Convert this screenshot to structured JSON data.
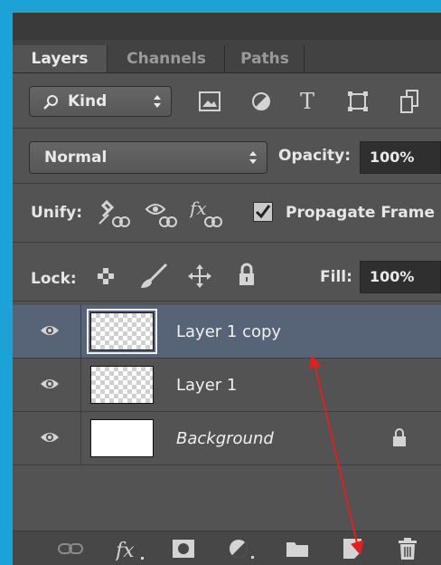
{
  "tabs": [
    {
      "label": "Layers",
      "active": true
    },
    {
      "label": "Channels",
      "active": false
    },
    {
      "label": "Paths",
      "active": false
    }
  ],
  "filter": {
    "kind_label": "Kind",
    "icons": [
      "image-filter-icon",
      "adjustment-filter-icon",
      "type-filter-icon",
      "shape-filter-icon",
      "smart-object-filter-icon"
    ]
  },
  "blend": {
    "mode": "Normal",
    "opacity_label": "Opacity:",
    "opacity_value": "100%"
  },
  "unify": {
    "label": "Unify:",
    "propagate_label": "Propagate Frame",
    "propagate_checked": true
  },
  "lock": {
    "label": "Lock:",
    "fill_label": "Fill:",
    "fill_value": "100%"
  },
  "layers": [
    {
      "name": "Layer 1 copy",
      "selected": true,
      "visible": true,
      "italic": false,
      "thumb": "transparent"
    },
    {
      "name": "Layer 1",
      "selected": false,
      "visible": true,
      "italic": false,
      "thumb": "transparent"
    },
    {
      "name": "Background",
      "selected": false,
      "visible": true,
      "italic": true,
      "thumb": "white",
      "locked": true
    }
  ],
  "bottom_icons": [
    "link-layers-icon",
    "fx-icon",
    "add-mask-icon",
    "adjustment-layer-icon",
    "new-group-icon",
    "new-layer-icon",
    "delete-layer-icon"
  ],
  "colors": {
    "panel": "#535353",
    "selected_row": "#576478",
    "annotation_arrow": "#e02020",
    "frame": "#1ba3d8"
  }
}
